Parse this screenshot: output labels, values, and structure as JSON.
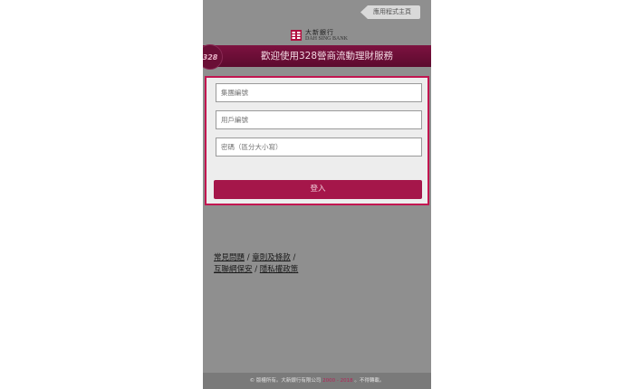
{
  "header": {
    "app_home_label": "應用程式主頁",
    "logo_cn": "大新銀行",
    "logo_en": "DAH SING BANK"
  },
  "banner": {
    "badge_text": "328",
    "title": "歡迎使用328營商流動理財服務"
  },
  "login_form": {
    "group_id_placeholder": "集團編號",
    "user_id_placeholder": "用戶編號",
    "password_placeholder": "密碼（區分大小寫）",
    "login_label": "登入"
  },
  "links": {
    "faq": "常見問題",
    "sep1": " / ",
    "terms": "章則及條款",
    "sep2": " /",
    "security": "互聯網保安",
    "sep3": " / ",
    "privacy": "隱私權政策"
  },
  "footer": {
    "prefix": "© 版權所有。大新銀行有限公司 ",
    "years": "2000 - 2018",
    "suffix": " 。不得轉載。"
  },
  "colors": {
    "brand": "#a5164a",
    "banner": "#6a0f36",
    "card_border": "#c21550"
  }
}
